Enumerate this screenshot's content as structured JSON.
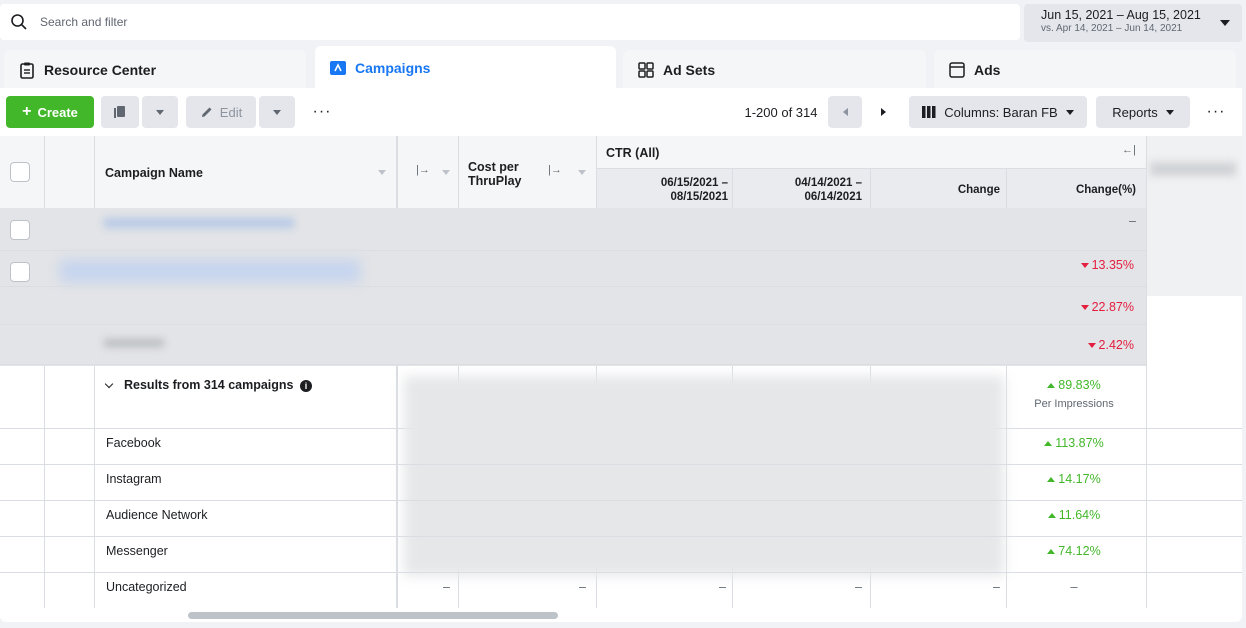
{
  "search": {
    "placeholder": "Search and filter"
  },
  "date_range": {
    "primary": "Jun 15, 2021 – Aug 15, 2021",
    "compare": "vs. Apr 14, 2021 – Jun 14, 2021"
  },
  "tabs": [
    {
      "label": "Resource Center",
      "icon": "clipboard-icon"
    },
    {
      "label": "Campaigns",
      "icon": "flag-icon"
    },
    {
      "label": "Ad Sets",
      "icon": "grid-icon"
    },
    {
      "label": "Ads",
      "icon": "ad-window-icon"
    }
  ],
  "toolbar": {
    "create_label": "Create",
    "edit_label": "Edit",
    "pagination": "1-200 of 314",
    "columns_label": "Columns: Baran FB",
    "reports_label": "Reports",
    "more": "···"
  },
  "table": {
    "col_campaign_name": "Campaign Name",
    "col_cost_per": "Cost per",
    "col_thruplay": "ThruPlay",
    "col_ctr_group": "CTR (All)",
    "col_period1": "06/15/2021 –",
    "col_period1b": "08/15/2021",
    "col_period2": "04/14/2021 –",
    "col_period2b": "06/14/2021",
    "col_change": "Change",
    "col_change_pct": "Change(%)",
    "rows_change_pct": [
      "–",
      "13.35%",
      "22.87%",
      "2.42%"
    ],
    "summary_label": "Results from 314 campaigns",
    "summary_change_pct": "89.83%",
    "summary_note": "Per Impressions",
    "placements": [
      {
        "name": "Facebook",
        "change_pct": "113.87%"
      },
      {
        "name": "Instagram",
        "change_pct": "14.17%"
      },
      {
        "name": "Audience Network",
        "change_pct": "11.64%"
      },
      {
        "name": "Messenger",
        "change_pct": "74.12%"
      },
      {
        "name": "Uncategorized",
        "change_pct": "–"
      }
    ],
    "dash": "–"
  },
  "colors": {
    "accent": "#1877f2",
    "create": "#42b72a",
    "negative": "#e41e3f",
    "positive": "#42b72a"
  }
}
